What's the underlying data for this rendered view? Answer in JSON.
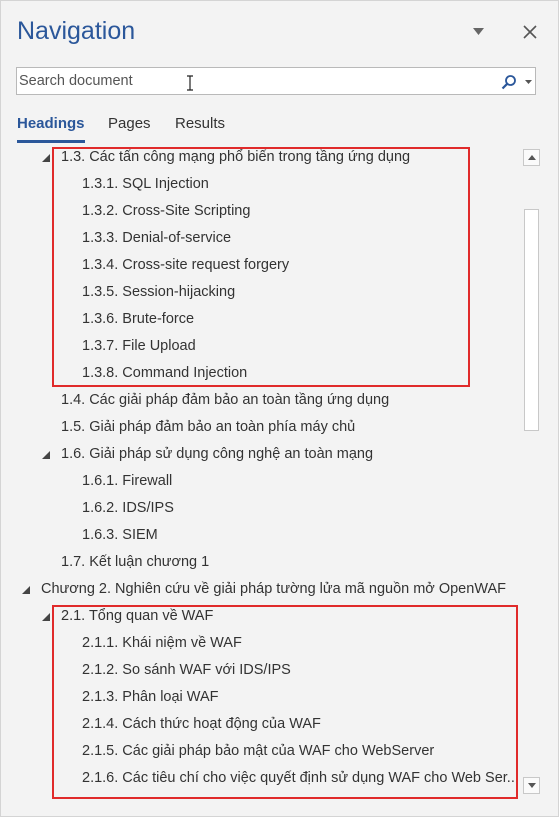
{
  "pane": {
    "title": "Navigation",
    "accent_color": "#2b579a",
    "highlight_color": "#e02a2a"
  },
  "search": {
    "placeholder": "Search document",
    "value": ""
  },
  "tabs": [
    {
      "label": "Headings",
      "active": true
    },
    {
      "label": "Pages",
      "active": false
    },
    {
      "label": "Results",
      "active": false
    }
  ],
  "tree": [
    {
      "label": "1.3. Các tấn công mạng phổ biến trong tầng ứng dụng",
      "level": 2,
      "expanded": true
    },
    {
      "label": "1.3.1. SQL Injection",
      "level": 3
    },
    {
      "label": "1.3.2. Cross-Site Scripting",
      "level": 3
    },
    {
      "label": "1.3.3. Denial-of-service",
      "level": 3
    },
    {
      "label": "1.3.4. Cross-site request forgery",
      "level": 3
    },
    {
      "label": "1.3.5. Session-hijacking",
      "level": 3
    },
    {
      "label": "1.3.6. Brute-force",
      "level": 3
    },
    {
      "label": "1.3.7. File Upload",
      "level": 3
    },
    {
      "label": "1.3.8. Command Injection",
      "level": 3
    },
    {
      "label": "1.4. Các giải pháp đảm bảo an toàn tầng ứng dụng",
      "level": 2
    },
    {
      "label": "1.5. Giải pháp đảm bảo an toàn phía máy chủ",
      "level": 2
    },
    {
      "label": "1.6. Giải pháp sử dụng công nghệ an toàn mạng",
      "level": 2,
      "expanded": true
    },
    {
      "label": "1.6.1. Firewall",
      "level": 3
    },
    {
      "label": "1.6.2. IDS/IPS",
      "level": 3
    },
    {
      "label": "1.6.3. SIEM",
      "level": 3
    },
    {
      "label": "1.7. Kết luận chương 1",
      "level": 2
    },
    {
      "label": "Chương 2. Nghiên cứu về giải pháp tường lửa mã nguồn mở OpenWAF",
      "level": 1,
      "expanded": true
    },
    {
      "label": "2.1. Tổng quan về WAF",
      "level": 2,
      "expanded": true
    },
    {
      "label": "2.1.1. Khái niệm về WAF",
      "level": 3
    },
    {
      "label": "2.1.2. So sánh WAF với IDS/IPS",
      "level": 3
    },
    {
      "label": "2.1.3. Phân loại WAF",
      "level": 3
    },
    {
      "label": "2.1.4. Cách thức hoạt động của WAF",
      "level": 3
    },
    {
      "label": "2.1.5. Các giải pháp bảo mật của WAF cho WebServer",
      "level": 3
    },
    {
      "label": "2.1.6. Các tiêu chí cho việc quyết định sử dụng WAF cho Web Ser...",
      "level": 3
    }
  ]
}
